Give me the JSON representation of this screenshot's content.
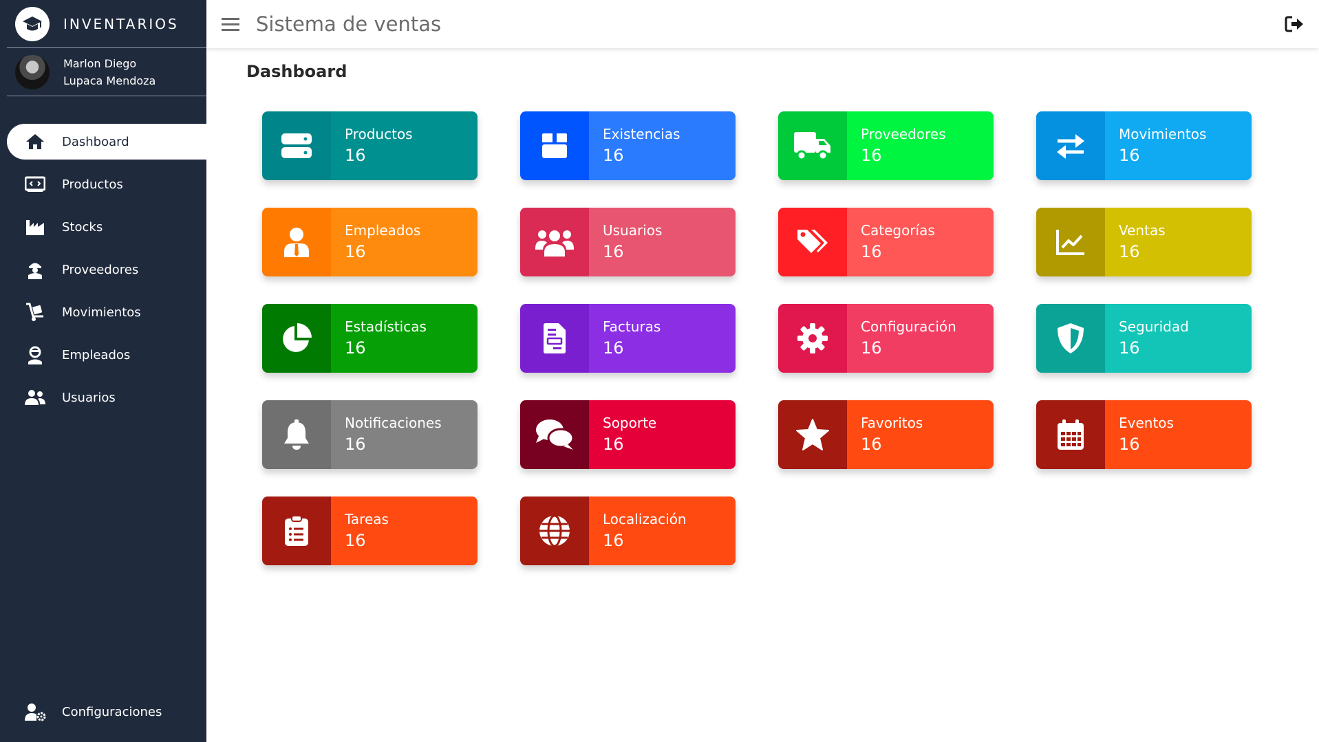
{
  "brand": {
    "name": "INVENTARIOS"
  },
  "user": {
    "name_line1": "Marlon Diego",
    "name_line2": "Lupaca Mendoza"
  },
  "sidebar": {
    "items": [
      {
        "label": "Dashboard",
        "icon": "home-icon",
        "active": true
      },
      {
        "label": "Productos",
        "icon": "product-icon"
      },
      {
        "label": "Stocks",
        "icon": "warehouse-icon"
      },
      {
        "label": "Proveedores",
        "icon": "supplier-icon"
      },
      {
        "label": "Movimientos",
        "icon": "cart-icon"
      },
      {
        "label": "Empleados",
        "icon": "employee-icon"
      },
      {
        "label": "Usuarios",
        "icon": "users-icon"
      }
    ],
    "bottom": {
      "label": "Configuraciones",
      "icon": "user-gear-icon"
    }
  },
  "header": {
    "title": "Sistema de ventas"
  },
  "main": {
    "title": "Dashboard",
    "cards": [
      {
        "label": "Productos",
        "value": "16",
        "icon": "server-icon",
        "colors": [
          "#00868a",
          "#009090"
        ]
      },
      {
        "label": "Existencias",
        "value": "16",
        "icon": "box-icon",
        "colors": [
          "#0055ff",
          "#2b7bff"
        ]
      },
      {
        "label": "Proveedores",
        "value": "16",
        "icon": "truck-icon",
        "colors": [
          "#00c93a",
          "#00f540"
        ]
      },
      {
        "label": "Movimientos",
        "value": "16",
        "icon": "arrows-exchange-icon",
        "colors": [
          "#0590e0",
          "#10aaf2"
        ]
      },
      {
        "label": "Empleados",
        "value": "16",
        "icon": "employee-tie-icon",
        "colors": [
          "#ff7a00",
          "#ff8b0e"
        ]
      },
      {
        "label": "Usuarios",
        "value": "16",
        "icon": "group-icon",
        "colors": [
          "#d92b54",
          "#e85570"
        ]
      },
      {
        "label": "Categorías",
        "value": "16",
        "icon": "tags-icon",
        "colors": [
          "#ff1f25",
          "#ff5656"
        ]
      },
      {
        "label": "Ventas",
        "value": "16",
        "icon": "chart-line-icon",
        "colors": [
          "#b09a00",
          "#d3c002"
        ]
      },
      {
        "label": "Estadísticas",
        "value": "16",
        "icon": "pie-chart-icon",
        "colors": [
          "#007a00",
          "#06a006"
        ]
      },
      {
        "label": "Facturas",
        "value": "16",
        "icon": "invoice-icon",
        "colors": [
          "#7a1fd0",
          "#8c2ee3"
        ]
      },
      {
        "label": "Configuración",
        "value": "16",
        "icon": "gear-icon",
        "colors": [
          "#e0184e",
          "#f23d63"
        ]
      },
      {
        "label": "Seguridad",
        "value": "16",
        "icon": "shield-icon",
        "colors": [
          "#0aa396",
          "#12c5b6"
        ]
      },
      {
        "label": "Notificaciones",
        "value": "16",
        "icon": "bell-icon",
        "colors": [
          "#707070",
          "#828282"
        ]
      },
      {
        "label": "Soporte",
        "value": "16",
        "icon": "chat-icon",
        "colors": [
          "#780020",
          "#e5003a"
        ]
      },
      {
        "label": "Favoritos",
        "value": "16",
        "icon": "star-icon",
        "colors": [
          "#a21a10",
          "#ff4a12"
        ]
      },
      {
        "label": "Eventos",
        "value": "16",
        "icon": "calendar-icon",
        "colors": [
          "#a21a10",
          "#ff4a12"
        ]
      },
      {
        "label": "Tareas",
        "value": "16",
        "icon": "clipboard-icon",
        "colors": [
          "#a21a10",
          "#ff4a12"
        ]
      },
      {
        "label": "Localización",
        "value": "16",
        "icon": "globe-icon",
        "colors": [
          "#a21a10",
          "#ff4a12"
        ]
      }
    ]
  }
}
